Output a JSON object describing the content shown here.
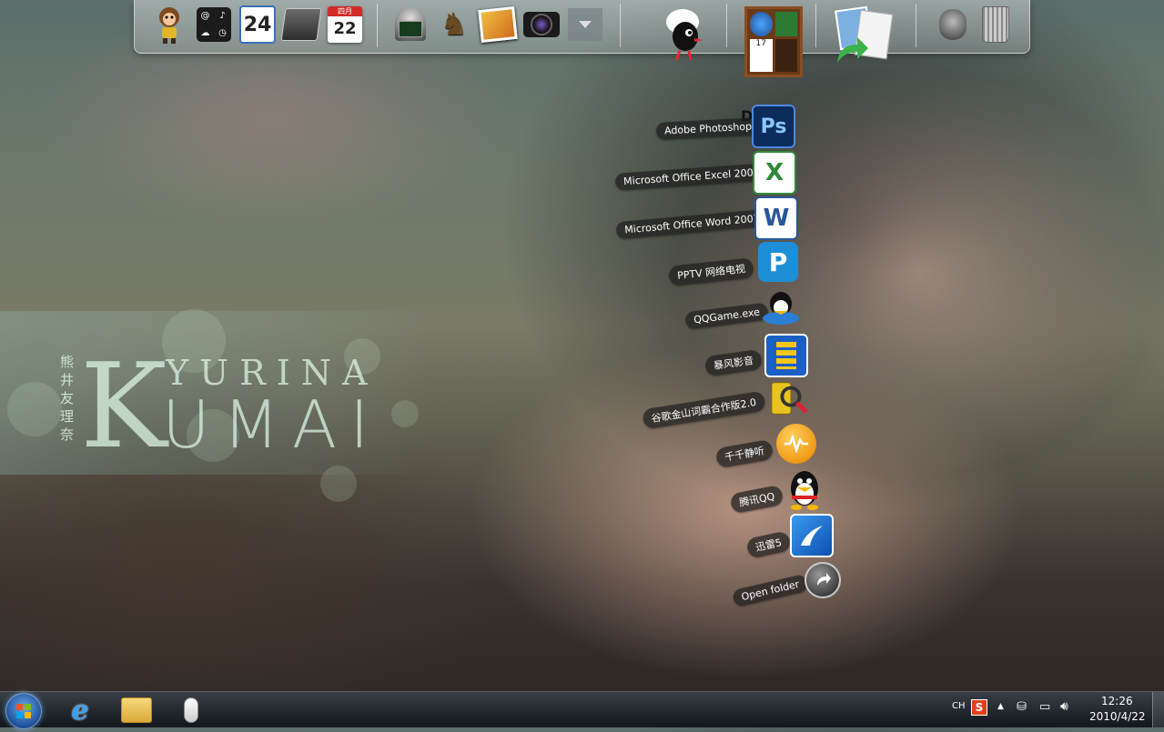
{
  "wallpaper": {
    "name_big_initial": "K",
    "name_top": "YURINA",
    "name_bottom": "UMAI",
    "kanji": [
      "熊",
      "井",
      "友",
      "理",
      "奈"
    ]
  },
  "dock": {
    "items": [
      {
        "name": "monkey-widget-icon"
      },
      {
        "name": "weather-clock-widget-icon"
      },
      {
        "name": "calendar-24-icon",
        "text": "24"
      },
      {
        "name": "notebook-icon"
      },
      {
        "name": "date-calendar-icon",
        "month": "四月",
        "day": "22"
      },
      {
        "name": "monitor-app-icon"
      },
      {
        "name": "chess-icon"
      },
      {
        "name": "photo-gallery-icon"
      },
      {
        "name": "camera-icon"
      },
      {
        "name": "more-dropdown-icon"
      },
      {
        "name": "cracked-egg-mascot-icon"
      },
      {
        "name": "bookshelf-stack-icon"
      },
      {
        "name": "rss-news-icon"
      },
      {
        "name": "speaker-settings-icon"
      },
      {
        "name": "recycle-bin-icon"
      }
    ]
  },
  "stack": {
    "header_partial": "D     rl",
    "items": [
      {
        "label": "Adobe Photoshop",
        "icon": "photoshop-icon",
        "icon_text": "Ps",
        "color": "#1b4e9b"
      },
      {
        "label": "Microsoft Office Excel 2007",
        "icon": "excel-icon",
        "icon_text": "X",
        "color": "#2f8a3a"
      },
      {
        "label": "Microsoft Office Word 2007",
        "icon": "word-icon",
        "icon_text": "W",
        "color": "#2b579a"
      },
      {
        "label": "PPTV 网络电视",
        "icon": "pptv-icon",
        "icon_text": "P",
        "color": "#1e8fd6"
      },
      {
        "label": "QQGame.exe",
        "icon": "qqgame-penguin-icon",
        "icon_text": "",
        "color": "#2a7fd4"
      },
      {
        "label": "暴风影音",
        "icon": "baofeng-player-icon",
        "icon_text": "",
        "color": "#1c5fc4"
      },
      {
        "label": "谷歌金山词霸合作版2.0",
        "icon": "dictionary-magnifier-icon",
        "icon_text": "",
        "color": "#e8c423"
      },
      {
        "label": "千千静听",
        "icon": "ttplayer-icon",
        "icon_text": "",
        "color": "#f09a16"
      },
      {
        "label": "腾讯QQ",
        "icon": "qq-penguin-icon",
        "icon_text": "",
        "color": "#222222"
      },
      {
        "label": "迅雷5",
        "icon": "thunder-icon",
        "icon_text": "",
        "color": "#1a6fd8"
      },
      {
        "label": "Open folder",
        "icon": "open-folder-arrow-icon",
        "icon_text": "",
        "color": "#555555"
      }
    ]
  },
  "taskbar": {
    "pinned": [
      {
        "name": "internet-explorer-icon"
      },
      {
        "name": "file-explorer-icon"
      },
      {
        "name": "mouse-app-icon"
      }
    ],
    "tray": {
      "language": "CH",
      "ime_badge": "S",
      "time": "12:26",
      "date": "2010/4/22"
    }
  }
}
